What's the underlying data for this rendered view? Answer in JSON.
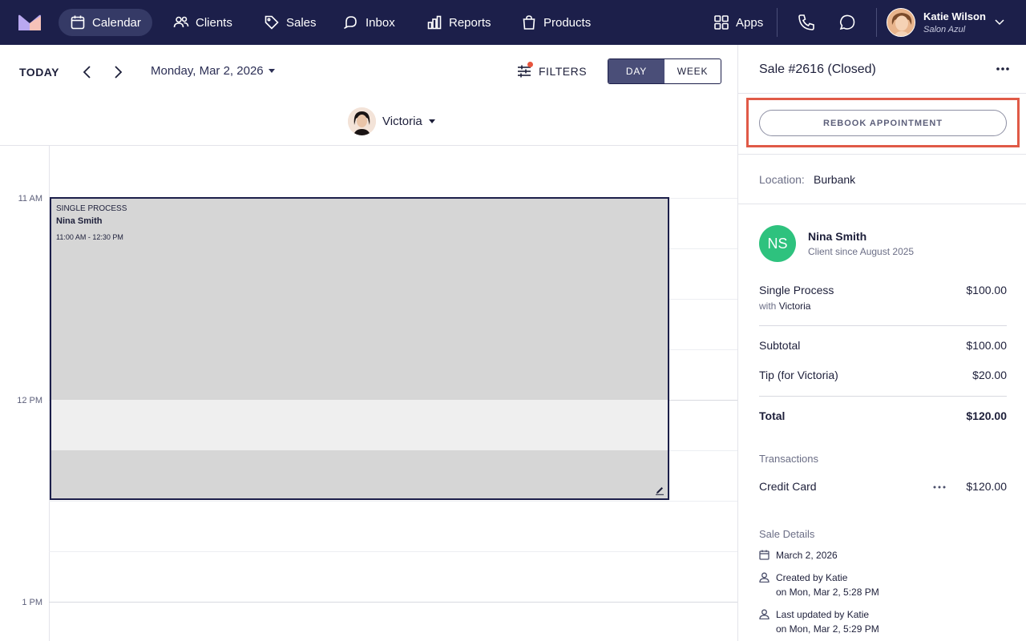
{
  "nav": {
    "items": [
      {
        "label": "Calendar",
        "icon": "calendar-icon",
        "active": true
      },
      {
        "label": "Clients",
        "icon": "users-icon"
      },
      {
        "label": "Sales",
        "icon": "tag-icon"
      },
      {
        "label": "Inbox",
        "icon": "chat-bubble-icon"
      },
      {
        "label": "Reports",
        "icon": "bar-chart-icon"
      },
      {
        "label": "Products",
        "icon": "shopping-bag-icon"
      }
    ],
    "apps_label": "Apps",
    "user": {
      "name": "Katie Wilson",
      "salon": "Salon Azul"
    }
  },
  "toolbar": {
    "today_label": "TODAY",
    "date": "Monday, Mar 2, 2026",
    "filters_label": "FILTERS",
    "day_label": "DAY",
    "week_label": "WEEK",
    "active_view": "DAY",
    "staff": "Victoria"
  },
  "calendar": {
    "time_labels": [
      "11 AM",
      "12 PM",
      "1 PM"
    ],
    "appointment": {
      "service": "SINGLE PROCESS",
      "client": "Nina Smith",
      "time": "11:00 AM - 12:30 PM"
    }
  },
  "panel": {
    "title": "Sale #2616 (Closed)",
    "rebook_label": "REBOOK APPOINTMENT",
    "location_label": "Location:",
    "location": "Burbank",
    "client": {
      "initials": "NS",
      "name": "Nina Smith",
      "since": "Client since August 2025",
      "avatar_color": "#2ec27e"
    },
    "service": {
      "name": "Single Process",
      "with_label": "with",
      "staff": "Victoria",
      "amount": "$100.00"
    },
    "subtotal": {
      "label": "Subtotal",
      "amount": "$100.00"
    },
    "tip": {
      "label": "Tip (for Victoria)",
      "amount": "$20.00"
    },
    "total": {
      "label": "Total",
      "amount": "$120.00"
    },
    "transactions_label": "Transactions",
    "transaction": {
      "method": "Credit Card",
      "amount": "$120.00"
    },
    "sale_details_label": "Sale Details",
    "sale_date": "March 2, 2026",
    "created_line1": "Created by Katie",
    "created_line2": "on Mon, Mar 2, 5:28 PM",
    "updated_line1": "Last updated by Katie",
    "updated_line2": "on Mon, Mar 2, 5:29 PM"
  },
  "colors": {
    "nav_bg": "#1c1f4a",
    "highlight": "#e05a47",
    "client_avatar": "#2ec27e"
  }
}
